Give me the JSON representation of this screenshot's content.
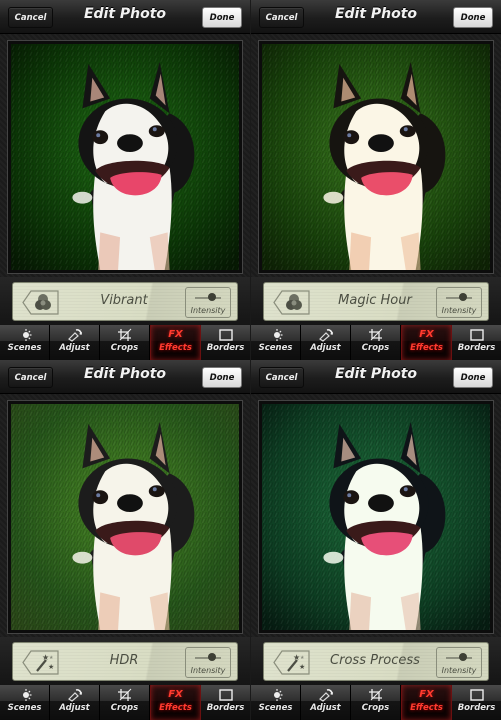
{
  "screens": [
    {
      "navbar": {
        "title": "Edit Photo",
        "cancel_label": "Cancel",
        "done_label": "Done"
      },
      "photo": {
        "subject": "Boston terrier on grass",
        "filter_look": "vibrant"
      },
      "effect_panel": {
        "filter_name": "Vibrant",
        "tag_icon": "color-circles-icon",
        "intensity_label": "Intensity",
        "intensity_level": 0.65
      },
      "tabs": [
        {
          "label": "Scenes",
          "icon": "scenes-icon",
          "active": false
        },
        {
          "label": "Adjust",
          "icon": "adjust-icon",
          "active": false
        },
        {
          "label": "Crops",
          "icon": "crop-icon",
          "active": false
        },
        {
          "label": "Effects",
          "icon": "FX",
          "active": true
        },
        {
          "label": "Borders",
          "icon": "border-icon",
          "active": false
        }
      ]
    },
    {
      "navbar": {
        "title": "Edit Photo",
        "cancel_label": "Cancel",
        "done_label": "Done"
      },
      "photo": {
        "subject": "Boston terrier on grass",
        "filter_look": "magic-hour"
      },
      "effect_panel": {
        "filter_name": "Magic Hour",
        "tag_icon": "color-circles-icon",
        "intensity_label": "Intensity",
        "intensity_level": 0.65
      },
      "tabs": [
        {
          "label": "Scenes",
          "icon": "scenes-icon",
          "active": false
        },
        {
          "label": "Adjust",
          "icon": "adjust-icon",
          "active": false
        },
        {
          "label": "Crops",
          "icon": "crop-icon",
          "active": false
        },
        {
          "label": "Effects",
          "icon": "FX",
          "active": true
        },
        {
          "label": "Borders",
          "icon": "border-icon",
          "active": false
        }
      ]
    },
    {
      "navbar": {
        "title": "Edit Photo",
        "cancel_label": "Cancel",
        "done_label": "Done"
      },
      "photo": {
        "subject": "Boston terrier on grass",
        "filter_look": "hdr"
      },
      "effect_panel": {
        "filter_name": "HDR",
        "tag_icon": "magic-wand-icon",
        "intensity_label": "Intensity",
        "intensity_level": 0.65
      },
      "tabs": [
        {
          "label": "Scenes",
          "icon": "scenes-icon",
          "active": false
        },
        {
          "label": "Adjust",
          "icon": "adjust-icon",
          "active": false
        },
        {
          "label": "Crops",
          "icon": "crop-icon",
          "active": false
        },
        {
          "label": "Effects",
          "icon": "FX",
          "active": true
        },
        {
          "label": "Borders",
          "icon": "border-icon",
          "active": false
        }
      ]
    },
    {
      "navbar": {
        "title": "Edit Photo",
        "cancel_label": "Cancel",
        "done_label": "Done"
      },
      "photo": {
        "subject": "Boston terrier on grass",
        "filter_look": "cross-process"
      },
      "effect_panel": {
        "filter_name": "Cross Process",
        "tag_icon": "magic-wand-icon",
        "intensity_label": "Intensity",
        "intensity_level": 0.65
      },
      "tabs": [
        {
          "label": "Scenes",
          "icon": "scenes-icon",
          "active": false
        },
        {
          "label": "Adjust",
          "icon": "adjust-icon",
          "active": false
        },
        {
          "label": "Crops",
          "icon": "crop-icon",
          "active": false
        },
        {
          "label": "Effects",
          "icon": "FX",
          "active": true
        },
        {
          "label": "Borders",
          "icon": "border-icon",
          "active": false
        }
      ]
    }
  ],
  "theme": {
    "accent_red": "#ff3b2f",
    "lcd_bg": "#d9ddc4",
    "lcd_text": "#4b4e42",
    "navbar_bg": "#1d1d1d"
  },
  "photo_palettes": {
    "vibrant": {
      "grass": "#1f6e14",
      "grass_dark": "#0b3506",
      "vignette": "#061a03",
      "fur_dark": "#141414",
      "fur_white": "#f4f3ee",
      "tongue": "#e8466a",
      "skin": "#e7b7a2"
    },
    "magic-hour": {
      "grass": "#3a7a1e",
      "grass_dark": "#17400a",
      "vignette": "#0e2305",
      "fur_dark": "#161410",
      "fur_white": "#fbf6e6",
      "tongue": "#ea4e6a",
      "skin": "#eebf9c"
    },
    "hdr": {
      "grass": "#4a8a24",
      "grass_dark": "#25551a",
      "vignette": "#2a4818",
      "fur_dark": "#1c1c1c",
      "fur_white": "#f6f4ea",
      "tongue": "#e04a6a",
      "skin": "#e9bca2"
    },
    "cross-process": {
      "grass": "#1d6e3a",
      "grass_dark": "#0d3d22",
      "vignette": "#061d12",
      "fur_dark": "#0f1418",
      "fur_white": "#f6fbef",
      "tongue": "#e74f78",
      "skin": "#e7c1ad"
    }
  }
}
